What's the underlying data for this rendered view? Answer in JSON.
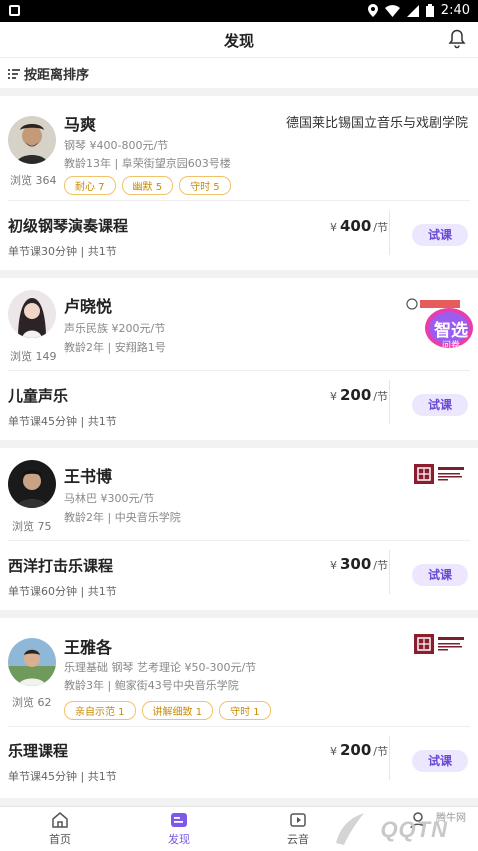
{
  "status_bar": {
    "time": "2:40"
  },
  "header": {
    "title": "发现"
  },
  "sort": {
    "label": "按距离排序"
  },
  "teachers": [
    {
      "name": "马爽",
      "school": "德国莱比锡国立音乐与戏剧学院",
      "instrument_price": "钢琴 ¥400-800元/节",
      "meta": "教龄13年 | 阜荣街望京园603号楼",
      "views": "浏览 364",
      "tags": [
        "耐心 7",
        "幽默 5",
        "守时 5"
      ],
      "course": {
        "title": "初级钢琴演奏课程",
        "meta": "单节课30分钟 | 共1节",
        "currency": "¥",
        "price": "400",
        "unit": "/节",
        "button": "试课"
      }
    },
    {
      "name": "卢晓悦",
      "school": "",
      "instrument_price": "声乐民族 ¥200元/节",
      "meta": "教龄2年 | 安翔路1号",
      "views": "浏览 149",
      "tags": [],
      "course": {
        "title": "儿童声乐",
        "meta": "单节课45分钟 | 共1节",
        "currency": "¥",
        "price": "200",
        "unit": "/节",
        "button": "试课"
      }
    },
    {
      "name": "王书博",
      "school": "",
      "instrument_price": "马林巴 ¥300元/节",
      "meta": "教龄2年 | 中央音乐学院",
      "views": "浏览 75",
      "tags": [],
      "course": {
        "title": "西洋打击乐课程",
        "meta": "单节课60分钟 | 共1节",
        "currency": "¥",
        "price": "300",
        "unit": "/节",
        "button": "试课"
      }
    },
    {
      "name": "王雅各",
      "school": "",
      "instrument_price": "乐理基础 钢琴 艺考理论 ¥50-300元/节",
      "meta": "教龄3年 | 鲍家街43号中央音乐学院",
      "views": "浏览 62",
      "tags": [
        "亲自示范 1",
        "讲解细致 1",
        "守时 1"
      ],
      "course": {
        "title": "乐理课程",
        "meta": "单节课45分钟 | 共1节",
        "currency": "¥",
        "price": "200",
        "unit": "/节",
        "button": "试课"
      }
    }
  ],
  "badge": {
    "text": "智选",
    "subtext": "问卷"
  },
  "bottom_nav": [
    {
      "label": "首页",
      "icon": "home-icon"
    },
    {
      "label": "发现",
      "icon": "discover-icon"
    },
    {
      "label": "云音",
      "icon": "cloud-music-icon"
    },
    {
      "label": "",
      "icon": "profile-icon"
    }
  ],
  "watermark": {
    "text": "QQTN",
    "small": "腾牛网"
  },
  "colors": {
    "accent": "#7c59e8",
    "tag": "#f0c36a",
    "trial_bg": "#ece7ff"
  }
}
